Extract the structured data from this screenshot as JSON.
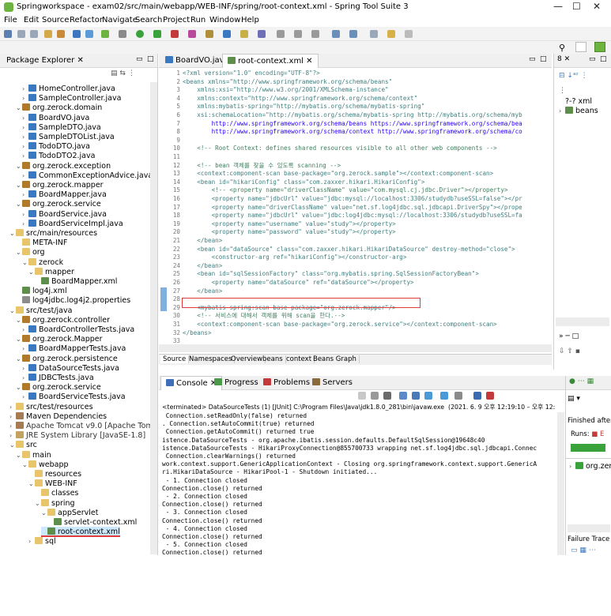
{
  "window": {
    "title": "Springworkspace - exam02/src/main/webapp/WEB-INF/spring/root-context.xml - Spring Tool Suite 3"
  },
  "menu": [
    "File",
    "Edit",
    "Source",
    "Refactor",
    "Navigate",
    "Search",
    "Project",
    "Run",
    "Window",
    "Help"
  ],
  "explorer": {
    "title": "Package Explorer",
    "items": [
      "HomeController.java",
      "SampleController.java",
      "org.zerock.domain",
      "BoardVO.java",
      "SampleDTO.java",
      "SampleDTOList.java",
      "TodoDTO.java",
      "TodoDTO2.java",
      "org.zerock.exception",
      "CommonExceptionAdvice.java",
      "org.zerock.mapper",
      "BoardMapper.java",
      "org.zerock.service",
      "BoardService.java",
      "BoardServiceImpl.java",
      "src/main/resources",
      "META-INF",
      "org",
      "zerock",
      "mapper",
      "BoardMapper.xml",
      "log4j.xml",
      "log4jdbc.log4j2.properties",
      "src/test/java",
      "org.zerock.controller",
      "BoardControllerTests.java",
      "org.zerock.Mapper",
      "BoardMapperTests.java",
      "org.zerock.persistence",
      "DataSourceTests.java",
      "JDBCTests.java",
      "org.zerock.service",
      "BoardServiceTests.java",
      "src/test/resources",
      "Maven Dependencies",
      "Apache Tomcat v9.0 [Apache Tomcat",
      "JRE System Library [JavaSE-1.8]",
      "src",
      "main",
      "webapp",
      "resources",
      "WEB-INF",
      "classes",
      "spring",
      "appServlet",
      "servlet-context.xml",
      "root-context.xml",
      "sql"
    ]
  },
  "editor": {
    "tabs": [
      "BoardVO.java",
      "root-context.xml"
    ],
    "lines": [
      "<?xml version=\"1.0\" encoding=\"UTF-8\"?>",
      "<beans xmlns=\"http://www.springframework.org/schema/beans\"",
      "    xmlns:xsi=\"http://www.w3.org/2001/XMLSchema-instance\"",
      "    xmlns:context=\"http://www.springframework.org/schema/context\"",
      "    xmlns:mybatis-spring=\"http://mybatis.org/schema/mybatis-spring\"",
      "    xsi:schemaLocation=\"http://mybatis.org/schema/mybatis-spring http://mybatis.org/schema/myb",
      "        http://www.springframework.org/schema/beans https://www.springframework.org/schema/bea",
      "        http://www.springframework.org/schema/context http://www.springframework.org/schema/co",
      "",
      "    <!-- Root Context: defines shared resources visible to all other web components -->",
      "",
      "    <!-- bean 객체를 찾을 수 있도록 scanning -->",
      "    <context:component-scan base-package=\"org.zerock.sample\"></context:component-scan>",
      "    <bean id=\"hikariConfig\" class=\"com.zaxxer.hikari.HikariConfig\">",
      "        <!-- <property name=\"driverClassName\" value=\"com.mysql.cj.jdbc.Driver\"></property>",
      "        <property name=\"jdbcUrl\" value=\"jdbc:mysql://localhost:3306/studydb?useSSL=false\"></pr",
      "        <property name=\"driverClassName\" value=\"net.sf.log4jdbc.sql.jdbcapi.DriverSpy\"></prope",
      "        <property name=\"jdbcUrl\" value=\"jdbc:log4jdbc:mysql://localhost:3306/studydb?useSSL=fa",
      "        <property name=\"username\" value=\"study\"></property>",
      "        <property name=\"password\" value=\"study\"></property>",
      "    </bean>",
      "    <bean id=\"dataSource\" class=\"com.zaxxer.hikari.HikariDataSource\" destroy-method=\"close\">",
      "        <constructor-arg ref=\"hikariConfig\"></constructor-arg>",
      "    </bean>",
      "    <bean id=\"sqlSessionFactory\" class=\"org.mybatis.spring.SqlSessionFactoryBean\">",
      "        <property name=\"dataSource\" ref=\"dataSource\"></property>",
      "    </bean>",
      "",
      "    <mybatis-spring:scan base-package=\"org.zerock.mapper\"/>",
      "    <!-- 서비스에 대해서 객체를 위해 scan을 한다.-->",
      "    <context:component-scan base-package=\"org.zerock.service\"></context:component-scan>",
      "</beans>",
      ""
    ],
    "bottom_tabs": [
      "Source",
      "Namespaces",
      "Overview",
      "beans",
      "context",
      "Beans Graph"
    ]
  },
  "console": {
    "tabs": [
      "Console",
      "Progress",
      "Problems",
      "Servers"
    ],
    "header": "<terminated> DataSourceTests (1) [JUnit] C:\\Program Files\\Java\\jdk1.8.0_281\\bin\\javaw.exe  (2021. 6. 9 오후 12:19:10 – 오후 12:",
    "lines": [
      " Connection.setReadOnly(false) returned",
      ". Connection.setAutoCommit(true) returned",
      " Connection.getAutoCommit() returned true",
      "istence.DataSourceTests - org.apache.ibatis.session.defaults.DefaultSqlSession@19648c40",
      "istence.DataSourceTests - HikariProxyConnection@855700733 wrapping net.sf.log4jdbc.sql.jdbcapi.Connec",
      " Connection.clearWarnings() returned",
      "work.context.support.GenericApplicationContext - Closing org.springframework.context.support.GenericA",
      "ri.HikariDataSource - HikariPool-1 - Shutdown initiated...",
      " - 1. Connection closed",
      "Connection.close() returned",
      " - 2. Connection closed",
      "Connection.close() returned",
      " - 3. Connection closed",
      "Connection.close() returned",
      " - 4. Connection closed",
      "Connection.close() returned",
      " - 5. Connection closed",
      "Connection.close() returned"
    ]
  },
  "outline": {
    "items": [
      "?-? xml",
      "beans"
    ]
  },
  "junit": {
    "finished": "Finished after",
    "runs_label": "Runs:",
    "runs_value": "",
    "tree_item": "org.zer",
    "failure": "Failure Trace"
  },
  "colors": {
    "accent": "#6db33f",
    "highlight": "#e23b3b",
    "select": "#cce8ff"
  }
}
